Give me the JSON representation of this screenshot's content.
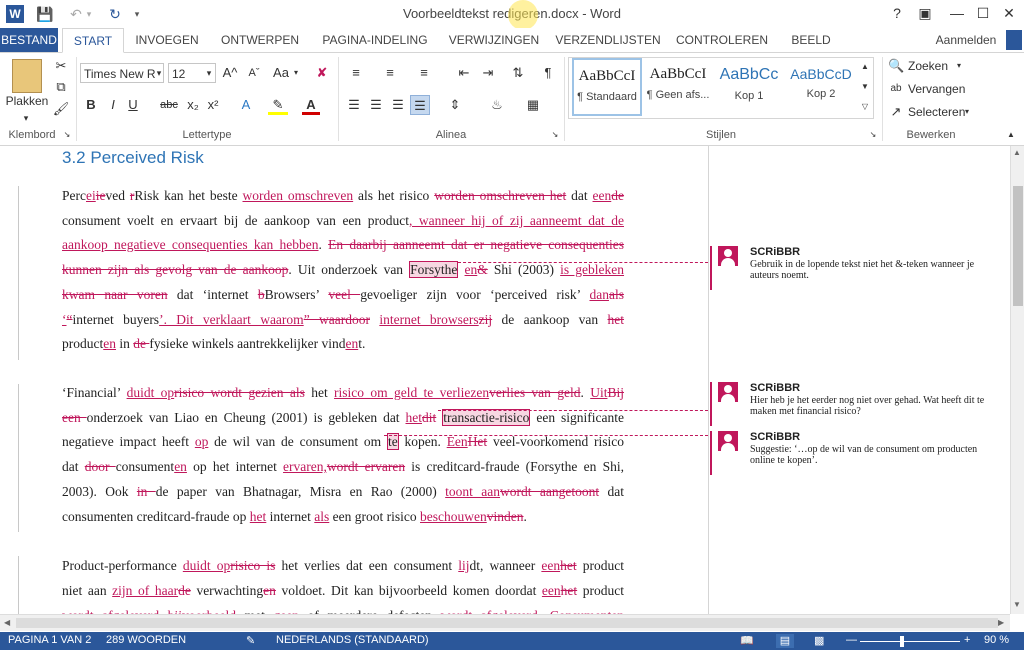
{
  "title_bar": {
    "title": "Voorbeeldtekst redigeren.docx - Word",
    "word_icon": "word-app-icon",
    "help": "?"
  },
  "tabs": {
    "file": "BESTAND",
    "items": [
      "START",
      "INVOEGEN",
      "ONTWERPEN",
      "PAGINA-INDELING",
      "VERWIJZINGEN",
      "VERZENDLIJSTEN",
      "CONTROLEREN",
      "BEELD"
    ],
    "signin": "Aanmelden"
  },
  "ribbon": {
    "clipboard": {
      "paste": "Plakken",
      "label": "Klembord"
    },
    "font": {
      "name": "Times New R",
      "size": "12",
      "label": "Lettertype",
      "bold": "B",
      "italic": "I",
      "underline": "U",
      "strike": "abc",
      "sub": "x₂",
      "sup": "x²",
      "grow": "A^",
      "shrink": "Aˇ",
      "case": "Aa"
    },
    "paragraph": {
      "label": "Alinea",
      "pilcrow": "¶"
    },
    "styles": {
      "label": "Stijlen",
      "items": [
        {
          "sample": "AaBbCcI",
          "name": "¶ Standaard"
        },
        {
          "sample": "AaBbCcI",
          "name": "¶ Geen afs..."
        },
        {
          "sample": "AaBbCc",
          "name": "Kop 1"
        },
        {
          "sample": "AaBbCcD",
          "name": "Kop 2"
        }
      ]
    },
    "editing": {
      "label": "Bewerken",
      "find": "Zoeken",
      "replace": "Vervangen",
      "select": "Selecteren"
    }
  },
  "document": {
    "heading": "3.2 Perceived Risk"
  },
  "comments": [
    {
      "author": "SCRiBBR",
      "text": "Gebruik in de lopende tekst niet het &-teken wanneer je auteurs noemt."
    },
    {
      "author": "SCRiBBR",
      "text": "Hier heb je het eerder nog niet over gehad. Wat heeft dit te maken met financial risico?"
    },
    {
      "author": "SCRiBBR",
      "text": "Suggestie: ‘…op de wil van de consument om producten online te kopen’."
    }
  ],
  "status": {
    "page": "PAGINA 1 VAN 2",
    "words": "289 WOORDEN",
    "language": "NEDERLANDS (STANDAARD)",
    "zoom": "90 %"
  },
  "colors": {
    "accent": "#2b579a",
    "revision": "#c0175b",
    "heading": "#2e74b5"
  }
}
